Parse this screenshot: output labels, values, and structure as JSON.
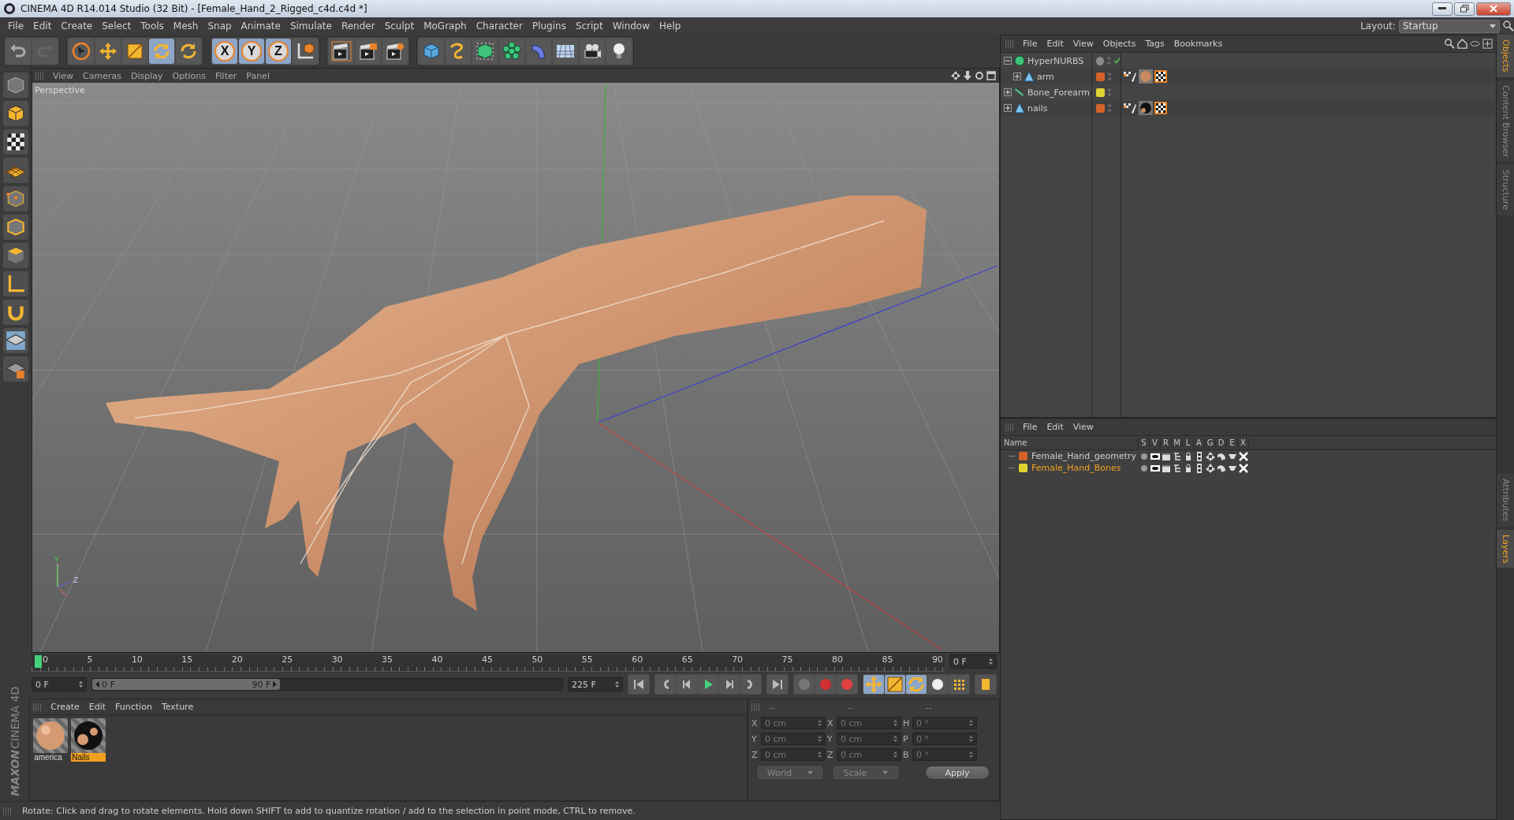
{
  "window": {
    "title": "CINEMA 4D R14.014 Studio (32 Bit) - [Female_Hand_2_Rigged_c4d.c4d *]"
  },
  "menu": [
    "File",
    "Edit",
    "Create",
    "Select",
    "Tools",
    "Mesh",
    "Snap",
    "Animate",
    "Simulate",
    "Render",
    "Sculpt",
    "MoGraph",
    "Character",
    "Plugins",
    "Script",
    "Window",
    "Help"
  ],
  "layout": {
    "label": "Layout:",
    "value": "Startup"
  },
  "toolbar": [
    {
      "tools": [
        {
          "kind": "undo",
          "selected": false
        },
        {
          "kind": "redo",
          "selected": false
        }
      ]
    },
    {
      "tools": [
        {
          "kind": "select",
          "selected": false
        },
        {
          "kind": "move",
          "selected": false
        },
        {
          "kind": "scale",
          "selected": false
        },
        {
          "kind": "rotate",
          "selected": true
        },
        {
          "kind": "recent",
          "selected": false
        }
      ]
    },
    {
      "tools": [
        {
          "kind": "axis",
          "label": "X",
          "selected": true
        },
        {
          "kind": "axis",
          "label": "Y",
          "selected": true
        },
        {
          "kind": "axis",
          "label": "Z",
          "selected": true
        },
        {
          "kind": "coord",
          "selected": false
        }
      ]
    },
    {
      "tools": [
        {
          "kind": "render-view",
          "selected": false
        },
        {
          "kind": "render-picture",
          "selected": false
        },
        {
          "kind": "render-settings",
          "selected": false
        }
      ]
    },
    {
      "tools": [
        {
          "kind": "cube",
          "selected": false
        },
        {
          "kind": "spline",
          "selected": false
        },
        {
          "kind": "nurbs",
          "selected": false
        },
        {
          "kind": "array",
          "selected": false
        },
        {
          "kind": "deformer",
          "selected": false
        },
        {
          "kind": "floor",
          "selected": false
        },
        {
          "kind": "camera",
          "selected": false
        },
        {
          "kind": "light",
          "selected": false
        }
      ]
    }
  ],
  "viewport": {
    "menu": [
      "View",
      "Cameras",
      "Display",
      "Options",
      "Filter",
      "Panel"
    ],
    "camera": "Perspective",
    "gizmo": [
      "Y",
      "Z"
    ]
  },
  "timeline": {
    "ruler": [
      "0",
      "5",
      "10",
      "15",
      "20",
      "25",
      "30",
      "35",
      "40",
      "45",
      "50",
      "55",
      "60",
      "65",
      "70",
      "75",
      "80",
      "85",
      "90"
    ],
    "playhead": {
      "level": 0
    },
    "current_frame": "0 F",
    "start_field": "0 F",
    "range_start": "0 F",
    "range_end": "90 F",
    "end_field": "225 F",
    "range": {
      "level": 0.4
    }
  },
  "materials": {
    "menu": [
      "Create",
      "Edit",
      "Function",
      "Texture"
    ],
    "items": [
      {
        "name": "america",
        "kind": "skin",
        "selected": false
      },
      {
        "name": "Nails",
        "kind": "nails",
        "selected": true
      }
    ]
  },
  "coordinates": {
    "headers": [
      "--",
      "--",
      "--"
    ],
    "rows": [
      [
        {
          "axis": "X",
          "value": "0 cm"
        },
        {
          "axis": "X",
          "value": "0 cm"
        },
        {
          "axis": "H",
          "value": "0 °"
        }
      ],
      [
        {
          "axis": "Y",
          "value": "0 cm"
        },
        {
          "axis": "Y",
          "value": "0 cm"
        },
        {
          "axis": "P",
          "value": "0 °"
        }
      ],
      [
        {
          "axis": "Z",
          "value": "0 cm"
        },
        {
          "axis": "Z",
          "value": "0 cm"
        },
        {
          "axis": "B",
          "value": "0 °"
        }
      ]
    ],
    "dropdowns": [
      "World",
      "Scale"
    ],
    "apply": "Apply"
  },
  "status_bar": "Rotate: Click and drag to rotate elements. Hold down SHIFT to add to quantize rotation / add to the selection in point mode, CTRL to remove.",
  "logo": {
    "brand": "MAXON",
    "product": "CINEMA 4D"
  },
  "objects": {
    "menu": [
      "File",
      "Edit",
      "View",
      "Objects",
      "Tags",
      "Bookmarks"
    ],
    "tree": [
      {
        "name": "HyperNURBS",
        "kind": "nurbs",
        "color": "#8a8a8a",
        "expanded": true,
        "checkmark": true,
        "children": [
          {
            "name": "arm",
            "kind": "polygon",
            "color": "#d4622a",
            "expanded": false,
            "checkmark": false,
            "tags": [
              {
                "kind": "phong"
              },
              {
                "kind": "skin-material"
              },
              {
                "kind": "uvw"
              }
            ]
          }
        ]
      },
      {
        "name": "Bone_Forearm",
        "kind": "bone",
        "color": "#e0d230",
        "expanded": false,
        "checkmark": false
      },
      {
        "name": "nails",
        "kind": "polygon",
        "color": "#d4622a",
        "expanded": false,
        "checkmark": false,
        "tags": [
          {
            "kind": "phong"
          },
          {
            "kind": "nails-material"
          },
          {
            "kind": "uvw"
          }
        ]
      }
    ]
  },
  "layers": {
    "menu": [
      "File",
      "Edit",
      "View"
    ],
    "columns": [
      "Name",
      "S",
      "V",
      "R",
      "M",
      "L",
      "A",
      "G",
      "D",
      "E",
      "X"
    ],
    "rows": [
      {
        "name": "Female_Hand_geometry",
        "color": "#d4622a",
        "selected": false
      },
      {
        "name": "Female_Hand_Bones",
        "color": "#e0d230",
        "selected": true
      }
    ]
  },
  "side_tabs": {
    "top": [
      {
        "label": "Objects",
        "selected": true
      },
      {
        "label": "Content Browser",
        "selected": false
      },
      {
        "label": "Structure",
        "selected": false
      }
    ],
    "bottom": [
      {
        "label": "Attributes",
        "selected": false
      },
      {
        "label": "Layers",
        "selected": true
      }
    ]
  }
}
